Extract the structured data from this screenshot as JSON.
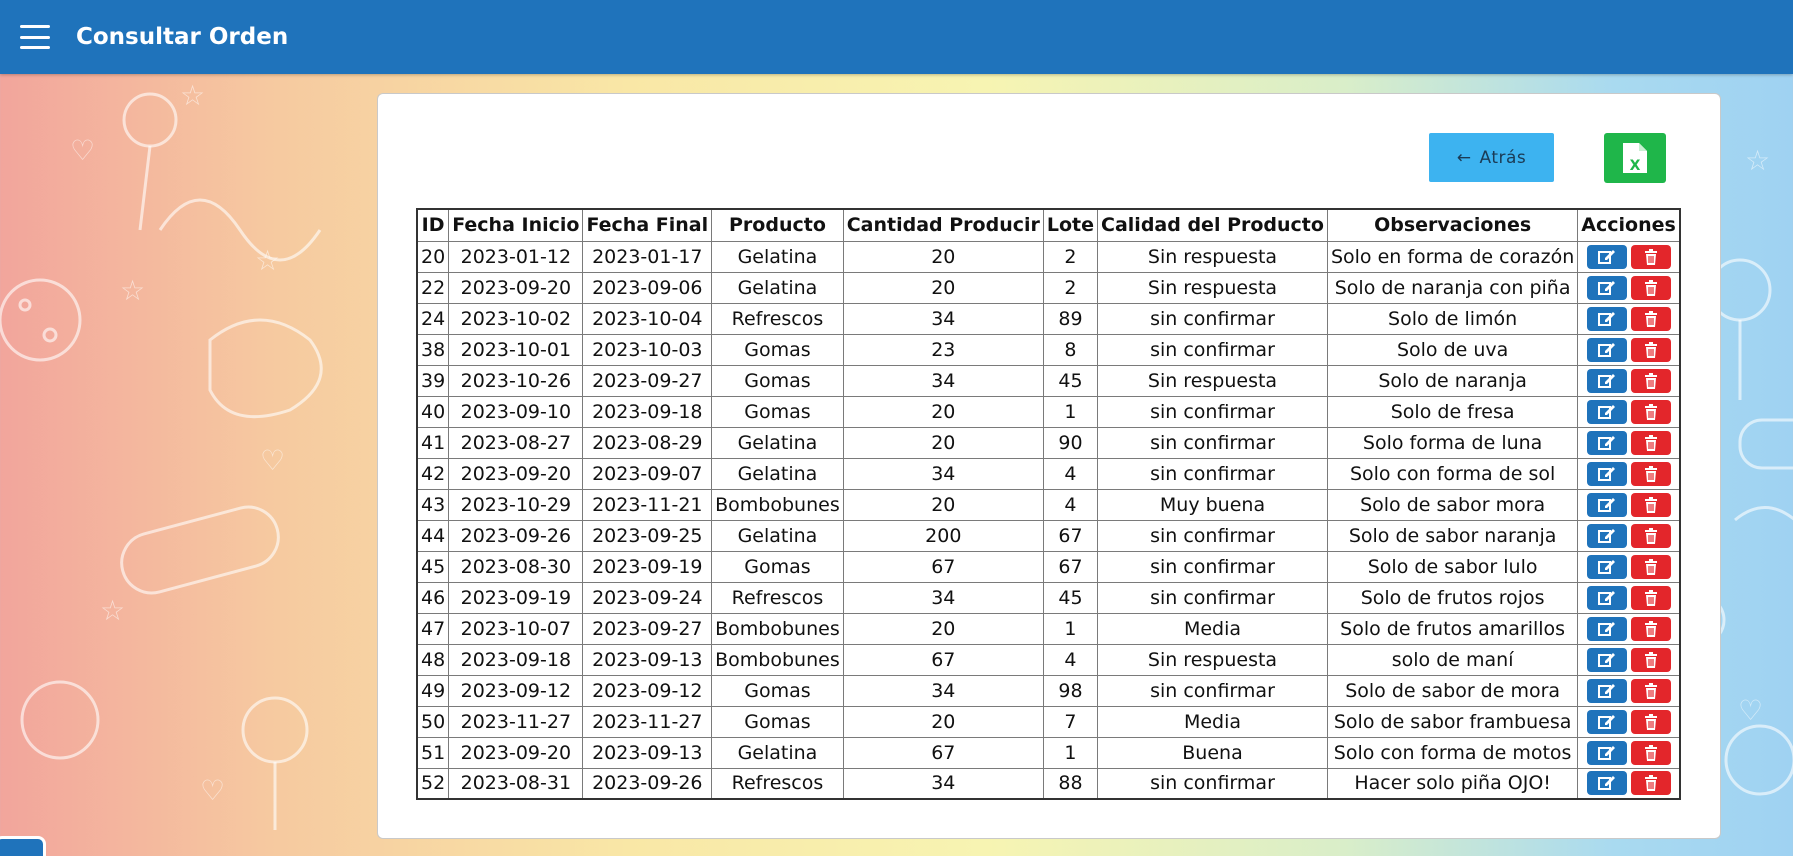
{
  "header": {
    "title": "Consultar Orden",
    "menu_icon": "hamburger-menu-icon",
    "color": "#1f73bb"
  },
  "toolbar": {
    "back_arrow": "←",
    "back_label": "Atrás",
    "back_color": "#3db3f0",
    "excel_icon": "excel-file-icon",
    "excel_letter": "X",
    "excel_color": "#1fb64a"
  },
  "table": {
    "headers": [
      "ID",
      "Fecha Inicio",
      "Fecha Final",
      "Producto",
      "Cantidad Producir",
      "Lote",
      "Calidad del Producto",
      "Observaciones",
      "Acciones"
    ],
    "rows": [
      [
        "20",
        "2023-01-12",
        "2023-01-17",
        "Gelatina",
        "20",
        "2",
        "Sin respuesta",
        "Solo en forma de corazón"
      ],
      [
        "22",
        "2023-09-20",
        "2023-09-06",
        "Gelatina",
        "20",
        "2",
        "Sin respuesta",
        "Solo de naranja con piña"
      ],
      [
        "24",
        "2023-10-02",
        "2023-10-04",
        "Refrescos",
        "34",
        "89",
        "sin confirmar",
        "Solo de limón"
      ],
      [
        "38",
        "2023-10-01",
        "2023-10-03",
        "Gomas",
        "23",
        "8",
        "sin confirmar",
        "Solo de uva"
      ],
      [
        "39",
        "2023-10-26",
        "2023-09-27",
        "Gomas",
        "34",
        "45",
        "Sin respuesta",
        "Solo de naranja"
      ],
      [
        "40",
        "2023-09-10",
        "2023-09-18",
        "Gomas",
        "20",
        "1",
        "sin confirmar",
        "Solo de fresa"
      ],
      [
        "41",
        "2023-08-27",
        "2023-08-29",
        "Gelatina",
        "20",
        "90",
        "sin confirmar",
        "Solo forma de luna"
      ],
      [
        "42",
        "2023-09-20",
        "2023-09-07",
        "Gelatina",
        "34",
        "4",
        "sin confirmar",
        "Solo con forma de sol"
      ],
      [
        "43",
        "2023-10-29",
        "2023-11-21",
        "Bombobunes",
        "20",
        "4",
        "Muy buena",
        "Solo de sabor mora"
      ],
      [
        "44",
        "2023-09-26",
        "2023-09-25",
        "Gelatina",
        "200",
        "67",
        "sin confirmar",
        "Solo de sabor naranja"
      ],
      [
        "45",
        "2023-08-30",
        "2023-09-19",
        "Gomas",
        "67",
        "67",
        "sin confirmar",
        "Solo de sabor lulo"
      ],
      [
        "46",
        "2023-09-19",
        "2023-09-24",
        "Refrescos",
        "34",
        "45",
        "sin confirmar",
        "Solo de frutos rojos"
      ],
      [
        "47",
        "2023-10-07",
        "2023-09-27",
        "Bombobunes",
        "20",
        "1",
        "Media",
        "Solo de frutos amarillos"
      ],
      [
        "48",
        "2023-09-18",
        "2023-09-13",
        "Bombobunes",
        "67",
        "4",
        "Sin respuesta",
        "solo de maní"
      ],
      [
        "49",
        "2023-09-12",
        "2023-09-12",
        "Gomas",
        "34",
        "98",
        "sin confirmar",
        "Solo de sabor de mora"
      ],
      [
        "50",
        "2023-11-27",
        "2023-11-27",
        "Gomas",
        "20",
        "7",
        "Media",
        "Solo de sabor frambuesa"
      ],
      [
        "51",
        "2023-09-20",
        "2023-09-13",
        "Gelatina",
        "67",
        "1",
        "Buena",
        "Solo con forma de motos"
      ],
      [
        "52",
        "2023-08-31",
        "2023-09-26",
        "Refrescos",
        "34",
        "88",
        "sin confirmar",
        "Hacer solo piña OJO!"
      ]
    ],
    "edit_icon": "edit-icon",
    "delete_icon": "trash-icon",
    "edit_color": "#1f73bb",
    "delete_color": "#e3262b"
  }
}
